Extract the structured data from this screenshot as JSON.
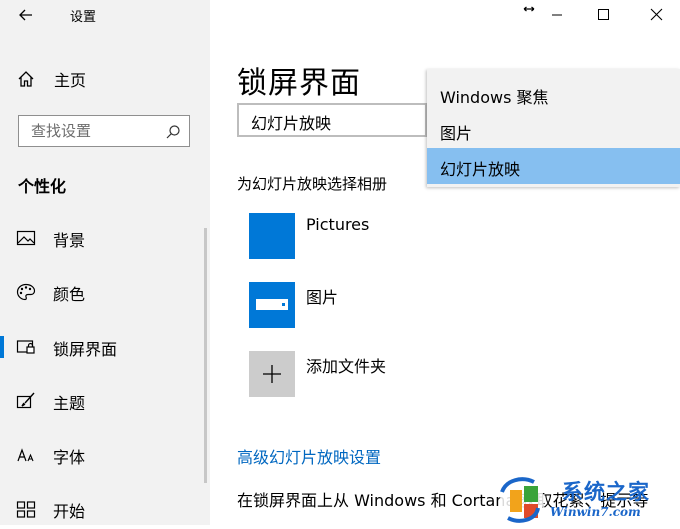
{
  "window": {
    "title": "设置",
    "back_icon": "arrow-left-icon",
    "controls": [
      "resize-cursor-icon",
      "minimize-icon",
      "maximize-icon",
      "close-icon"
    ]
  },
  "sidebar": {
    "home_label": "主页",
    "search_placeholder": "查找设置",
    "section_title": "个性化",
    "items": [
      {
        "label": "背景",
        "icon": "picture-icon",
        "selected": false
      },
      {
        "label": "颜色",
        "icon": "palette-icon",
        "selected": false
      },
      {
        "label": "锁屏界面",
        "icon": "lock-screen-icon",
        "selected": true
      },
      {
        "label": "主题",
        "icon": "brush-icon",
        "selected": false
      },
      {
        "label": "字体",
        "icon": "font-icon",
        "selected": false
      },
      {
        "label": "开始",
        "icon": "start-icon",
        "selected": false
      }
    ]
  },
  "main": {
    "title": "锁屏界面",
    "background_select_value": "幻灯片放映",
    "album_heading": "为幻灯片放映选择相册",
    "albums": [
      {
        "label": "Pictures",
        "icon": "folder-tile-icon"
      },
      {
        "label": "图片",
        "icon": "drive-tile-icon"
      },
      {
        "label": "添加文件夹",
        "icon": "plus-icon"
      }
    ],
    "advanced_link": "高级幻灯片放映设置",
    "info_text": "在锁屏界面上从 Windows 和 Cortana 获取花絮、提示等"
  },
  "dropdown": {
    "options": [
      "Windows 聚焦",
      "图片",
      "幻灯片放映"
    ],
    "selected": "幻灯片放映"
  },
  "watermark": {
    "brand": "系统之家",
    "url": "Winwin7.com"
  },
  "colors": {
    "accent": "#0078d7",
    "sidebar_bg": "#f2f2f2",
    "dropdown_selected": "#86bff0",
    "link": "#0067c0"
  }
}
